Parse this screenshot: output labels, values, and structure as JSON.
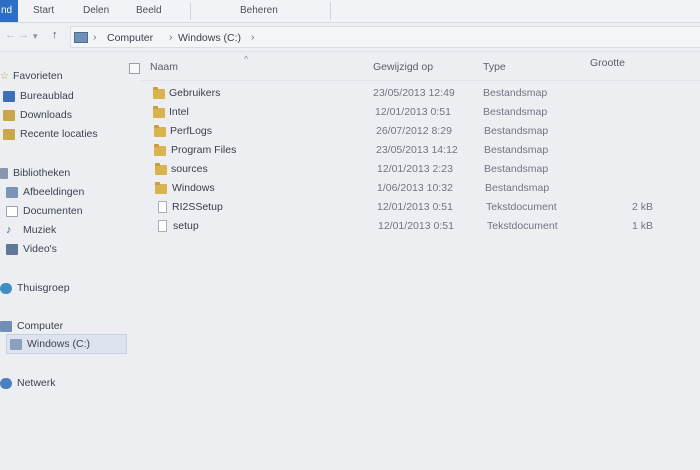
{
  "ribbon": {
    "file_tab": "nd",
    "tabs": [
      "Start",
      "Delen",
      "Beeld"
    ],
    "context_tab": "Beheren"
  },
  "address": {
    "back": "←",
    "forward": "→",
    "recent": "▾",
    "up": "↑",
    "crumbs": [
      "Computer",
      "Windows (C:)"
    ]
  },
  "sidebar": {
    "favorites": {
      "label": "Favorieten",
      "items": [
        "Bureaublad",
        "Downloads",
        "Recente locaties"
      ]
    },
    "libraries": {
      "label": "Bibliotheken",
      "items": [
        "Afbeeldingen",
        "Documenten",
        "Muziek",
        "Video's"
      ]
    },
    "homegroup": "Thuisgroep",
    "computer": {
      "label": "Computer",
      "items": [
        "Windows (C:)"
      ]
    },
    "network": "Netwerk"
  },
  "columns": {
    "name": "Naam",
    "modified": "Gewijzigd op",
    "type": "Type",
    "size": "Grootte"
  },
  "files": [
    {
      "name": "Gebruikers",
      "date": "23/05/2013 12:49",
      "type": "Bestandsmap",
      "size": "",
      "icon": "folder-icon"
    },
    {
      "name": "Intel",
      "date": "12/01/2013 0:51",
      "type": "Bestandsmap",
      "size": "",
      "icon": "folder-icon"
    },
    {
      "name": "PerfLogs",
      "date": "26/07/2012 8:29",
      "type": "Bestandsmap",
      "size": "",
      "icon": "folder-icon"
    },
    {
      "name": "Program Files",
      "date": "23/05/2013 14:12",
      "type": "Bestandsmap",
      "size": "",
      "icon": "folder-icon"
    },
    {
      "name": "sources",
      "date": "12/01/2013 2:23",
      "type": "Bestandsmap",
      "size": "",
      "icon": "folder-icon"
    },
    {
      "name": "Windows",
      "date": "1/06/2013 10:32",
      "type": "Bestandsmap",
      "size": "",
      "icon": "folder-icon"
    },
    {
      "name": "RI2SSetup",
      "date": "12/01/2013 0:51",
      "type": "Tekstdocument",
      "size": "2 kB",
      "icon": "text-document-icon"
    },
    {
      "name": "setup",
      "date": "12/01/2013 0:51",
      "type": "Tekstdocument",
      "size": "1 kB",
      "icon": "text-document-icon"
    }
  ],
  "colors": {
    "accent": "#2b6fc4",
    "folder": "#d9b34e",
    "selection": "#dde4ef"
  }
}
